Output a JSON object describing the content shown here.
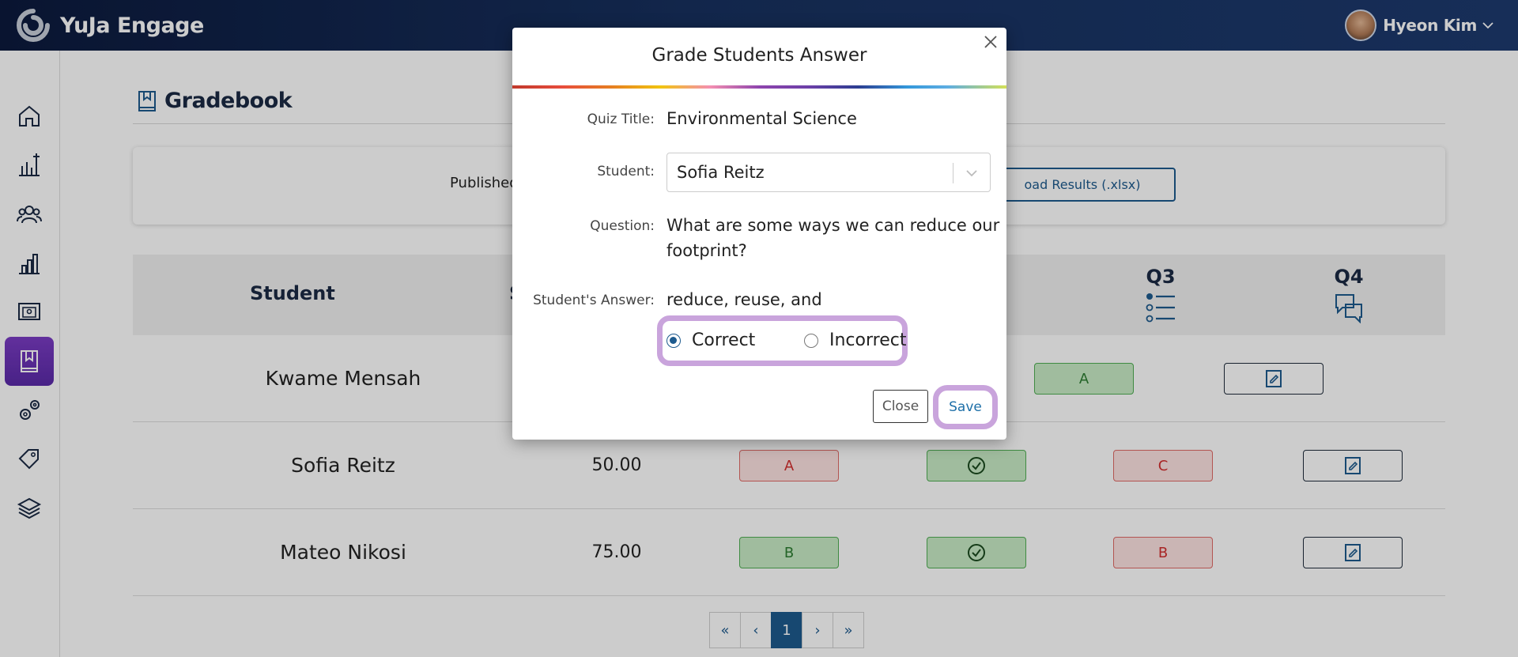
{
  "app": {
    "name": "YuJa Engage"
  },
  "user": {
    "name": "Hyeon Kim"
  },
  "sidebar": {
    "items": [
      {
        "name": "home-icon"
      },
      {
        "name": "analytics-add-icon"
      },
      {
        "name": "users-icon"
      },
      {
        "name": "bar-chart-icon"
      },
      {
        "name": "presentation-icon"
      },
      {
        "name": "gradebook-icon",
        "active": true
      },
      {
        "name": "settings-icon"
      },
      {
        "name": "tag-icon"
      },
      {
        "name": "layers-icon"
      }
    ]
  },
  "page": {
    "title": "Gradebook",
    "published_label": "Published",
    "download_label": "oad Results (.xlsx)"
  },
  "table": {
    "headers": {
      "student": "Student",
      "score": "S",
      "q3": "Q3",
      "q4": "Q4"
    },
    "rows": [
      {
        "name": "Kwame Mensah",
        "score": "",
        "q3": "A"
      },
      {
        "name": "Sofia Reitz",
        "score": "50.00",
        "q1": "A",
        "q3": "C"
      },
      {
        "name": "Mateo Nikosi",
        "score": "75.00",
        "q1": "B",
        "q3": "B"
      }
    ]
  },
  "pagination": {
    "first": "«",
    "prev": "‹",
    "current": "1",
    "next": "›",
    "last": "»"
  },
  "modal": {
    "title": "Grade Students Answer",
    "quiz_title_label": "Quiz Title:",
    "quiz_title": "Environmental Science",
    "student_label": "Student:",
    "student_value": "Sofia Reitz",
    "question_label": "Question:",
    "question_line1": "What are some ways we can reduce our",
    "question_line2": "footprint?",
    "answer_label": "Student's Answer:",
    "answer": "reduce, reuse, and",
    "options": {
      "correct": "Correct",
      "incorrect": "Incorrect",
      "selected": "Correct"
    },
    "close_label": "Close",
    "save_label": "Save"
  },
  "colors": {
    "topbar": "#0c1a3d",
    "accent": "#1d5a8e",
    "highlight": "#c9a4dc",
    "active_sidebar": "#7b3cc4",
    "correct_bg": "#c9ecc6",
    "incorrect_bg": "#fde3e2"
  }
}
